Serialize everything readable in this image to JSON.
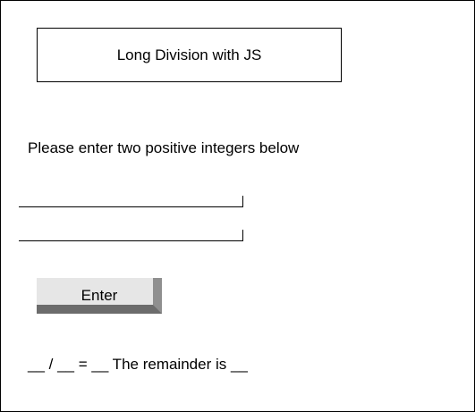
{
  "header": {
    "title": "Long Division with JS"
  },
  "form": {
    "prompt": "Please enter two positive integers below",
    "dividend_value": "",
    "divisor_value": "",
    "enter_label": "Enter"
  },
  "result": {
    "text": "__ / __ = __ The remainder is __"
  }
}
